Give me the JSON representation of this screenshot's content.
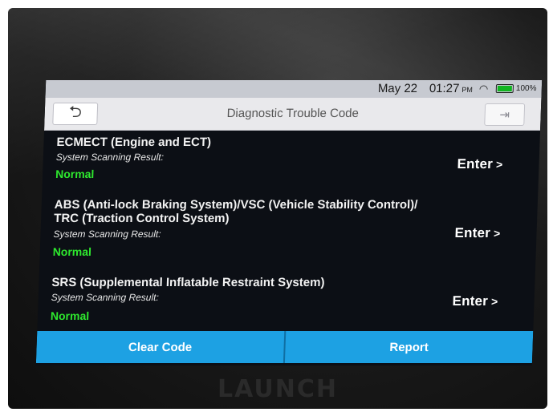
{
  "brand": {
    "logo_text": "LAUNCH"
  },
  "status_bar": {
    "date": "May 22",
    "time": "01:27",
    "ampm": "PM",
    "battery": "100%",
    "battery_level": 1.0,
    "wifi_icon": "wifi-icon",
    "battery_icon": "battery-icon"
  },
  "title_bar": {
    "title": "Diagnostic Trouble Code",
    "back_icon": "back-arrow-icon",
    "exit_icon": "exit-icon"
  },
  "systems": [
    {
      "name": "ECMECT (Engine and ECT)",
      "scan_label": "System Scanning Result:",
      "result": "Normal",
      "enter_label": "Enter"
    },
    {
      "name": "ABS (Anti-lock Braking System)/VSC (Vehicle Stability Control)/ TRC (Traction Control System)",
      "scan_label": "System Scanning Result:",
      "result": "Normal",
      "enter_label": "Enter"
    },
    {
      "name": "SRS (Supplemental Inflatable Restraint System)",
      "scan_label": "System Scanning Result:",
      "result": "Normal",
      "enter_label": "Enter"
    }
  ],
  "actions": {
    "clear_code": "Clear Code",
    "report": "Report"
  },
  "colors": {
    "accent": "#1da1e3",
    "status_normal": "#2ee82e",
    "screen_bg": "#0c0f15"
  }
}
